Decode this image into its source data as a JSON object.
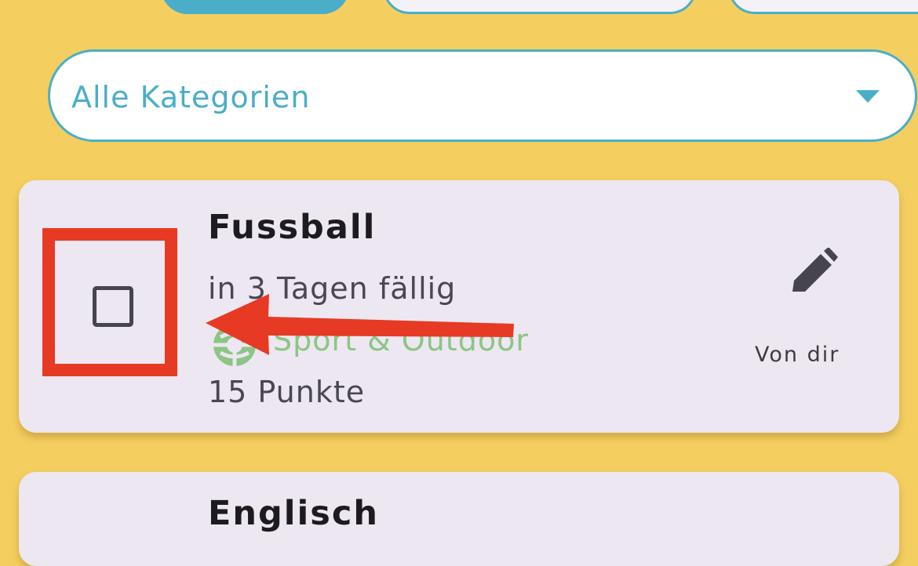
{
  "colors": {
    "background": "#f4cf60",
    "accent": "#4aaec8",
    "card": "#ede7f1",
    "category_green": "#8cc585",
    "highlight_red": "#e63a24"
  },
  "filter": {
    "selected": "Alle Kategorien",
    "icon": "chevron-down-icon"
  },
  "tasks": [
    {
      "title": "Fussball",
      "due": "in 3 Tagen fällig",
      "category": "Sport & Outdoor",
      "category_icon": "soccer-ball-icon",
      "points": "15 Punkte",
      "owner": "Von dir",
      "checked": false
    },
    {
      "title": "Englisch"
    }
  ]
}
